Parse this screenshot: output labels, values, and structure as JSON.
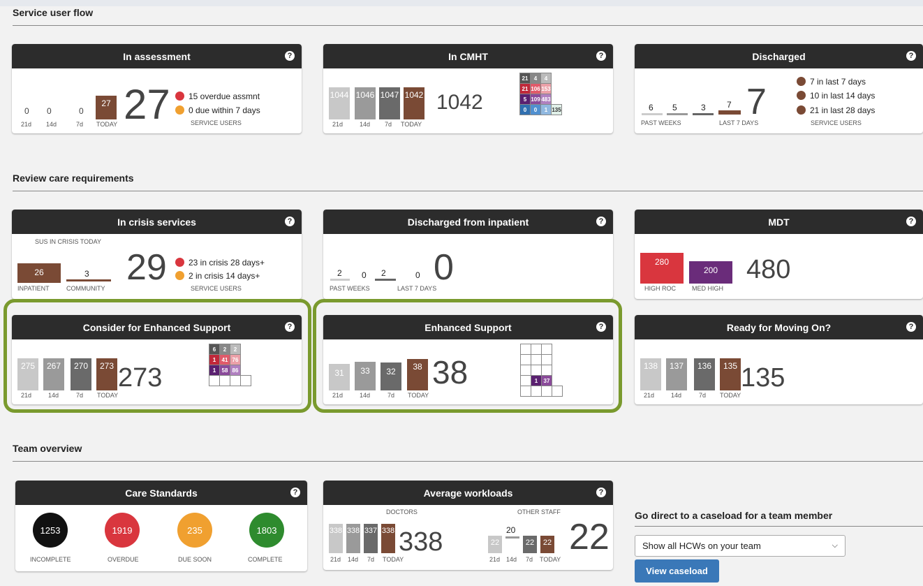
{
  "sections": {
    "flow": "Service user flow",
    "review": "Review care requirements",
    "team": "Team overview"
  },
  "assess": {
    "title": "In assessment",
    "v21": "0",
    "v14": "0",
    "v7": "0",
    "today": "27",
    "big": "27",
    "l21": "21d",
    "l14": "14d",
    "l7": "7d",
    "lt": "TODAY",
    "leg1": "15 overdue assmnt",
    "leg2": "0 due within 7 days",
    "foot": "SERVICE USERS"
  },
  "cmht": {
    "title": "In CMHT",
    "v21": "1044",
    "v14": "1046",
    "v7": "1047",
    "today": "1042",
    "big": "1042",
    "l21": "21d",
    "l14": "14d",
    "l7": "7d",
    "lt": "TODAY",
    "grid": [
      [
        "21",
        "4",
        "4"
      ],
      [
        "21",
        "106",
        "153"
      ],
      [
        "5",
        "109",
        "483"
      ],
      [
        "0",
        "0",
        "1",
        "135"
      ]
    ]
  },
  "disch": {
    "title": "Discharged",
    "w1": "6",
    "w2": "5",
    "w3": "3",
    "w4": "7",
    "big": "7",
    "lp": "PAST WEEKS",
    "l7": "LAST 7 DAYS",
    "leg1": "7 in last 7 days",
    "leg2": "10 in last 14 days",
    "leg3": "21 in last 28 days",
    "foot": "SERVICE USERS"
  },
  "crisis": {
    "title": "In crisis services",
    "top": "SUS IN CRISIS TODAY",
    "inp": "26",
    "comm": "3",
    "big": "29",
    "li": "INPATIENT",
    "lc": "COMMUNITY",
    "leg1": "23 in crisis 28 days+",
    "leg2": "2 in crisis 14 days+",
    "foot": "SERVICE USERS"
  },
  "inpat": {
    "title": "Discharged from inpatient",
    "w1": "2",
    "w2": "0",
    "w3": "2",
    "w4": "0",
    "big": "0",
    "lp": "PAST WEEKS",
    "l7": "LAST 7 DAYS"
  },
  "mdt": {
    "title": "MDT",
    "high": "280",
    "med": "200",
    "big": "480",
    "lh": "HIGH ROC",
    "lm": "MED HIGH"
  },
  "consider": {
    "title": "Consider for Enhanced Support",
    "v21": "275",
    "v14": "267",
    "v7": "270",
    "today": "273",
    "big": "273",
    "l21": "21d",
    "l14": "14d",
    "l7": "7d",
    "lt": "TODAY",
    "grid": [
      [
        "6",
        "2",
        "2"
      ],
      [
        "1",
        "41",
        "76"
      ],
      [
        "1",
        "58",
        "86"
      ]
    ]
  },
  "enh": {
    "title": "Enhanced Support",
    "v21": "31",
    "v14": "33",
    "v7": "32",
    "today": "38",
    "big": "38",
    "l21": "21d",
    "l14": "14d",
    "l7": "7d",
    "lt": "TODAY",
    "g1": "1",
    "g2": "37"
  },
  "ready": {
    "title": "Ready for Moving On?",
    "v21": "138",
    "v14": "137",
    "v7": "136",
    "today": "135",
    "big": "135",
    "l21": "21d",
    "l14": "14d",
    "l7": "7d",
    "lt": "TODAY"
  },
  "care": {
    "title": "Care Standards",
    "c1": "1253",
    "c2": "1919",
    "c3": "235",
    "c4": "1803",
    "l1": "INCOMPLETE",
    "l2": "OVERDUE",
    "l3": "DUE SOON",
    "l4": "COMPLETE"
  },
  "work": {
    "title": "Average workloads",
    "doc": "DOCTORS",
    "oth": "OTHER STAFF",
    "d21": "338",
    "d14": "338",
    "d7": "337",
    "dt": "338",
    "dbig": "338",
    "o21": "22",
    "o14": "20",
    "o7": "22",
    "ot": "22",
    "obig": "22",
    "l21": "21d",
    "l14": "14d",
    "l7": "7d",
    "lt": "TODAY"
  },
  "direct": {
    "title": "Go direct to a caseload for a team member",
    "select": "Show all HCWs on your team",
    "btn": "View caseload"
  },
  "colors": {
    "brown": "#7a4a35",
    "red": "#d9363e",
    "orange": "#f0a030",
    "purple": "#6a2c7a",
    "green": "#2e8b2e"
  }
}
